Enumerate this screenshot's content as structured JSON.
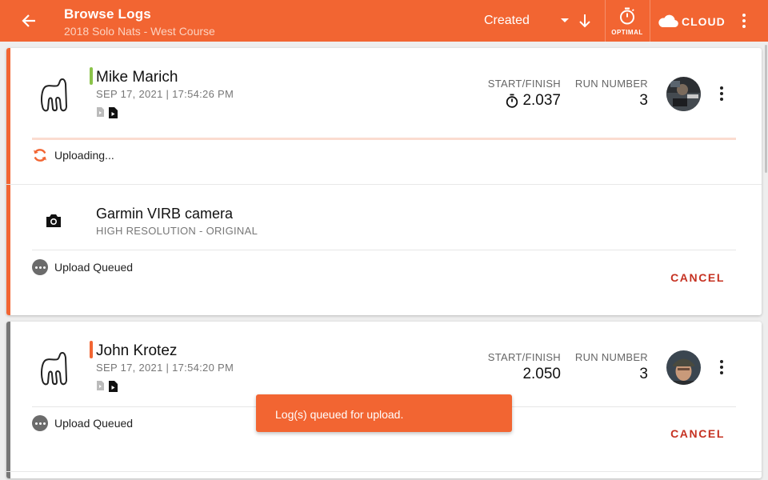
{
  "app_bar": {
    "title": "Browse Logs",
    "subtitle": "2018 Solo Nats - West Course",
    "sort_value": "Created",
    "optimal_label": "OPTIMAL",
    "cloud_label": "CLOUD",
    "color": "#f26532"
  },
  "logs": [
    {
      "driver": "Mike Marich",
      "date": "SEP 17, 2021 | 17:54:26 PM",
      "lap_color": "#8bc34a",
      "start_finish_label": "START/FINISH",
      "start_finish_value": "2.037",
      "start_finish_icon": "stopwatch-icon",
      "run_number_label": "RUN NUMBER",
      "run_number_value": "3",
      "upload_status": "Uploading...",
      "camera": {
        "title": "Garmin VIRB camera",
        "subtitle": "HIGH RESOLUTION - ORIGINAL",
        "status": "Upload Queued",
        "cancel_label": "CANCEL"
      }
    },
    {
      "driver": "John Krotez",
      "date": "SEP 17, 2021 | 17:54:20 PM",
      "lap_color": "#f26532",
      "start_finish_label": "START/FINISH",
      "start_finish_value": "2.050",
      "run_number_label": "RUN NUMBER",
      "run_number_value": "3",
      "upload_status": "Upload Queued",
      "cancel_label": "CANCEL"
    }
  ],
  "snackbar": {
    "message": "Log(s) queued for upload."
  },
  "colors": {
    "accent": "#f26532",
    "cancel": "#c63222",
    "card_accent_first": "#f26532",
    "card_accent_second": "#777777"
  }
}
